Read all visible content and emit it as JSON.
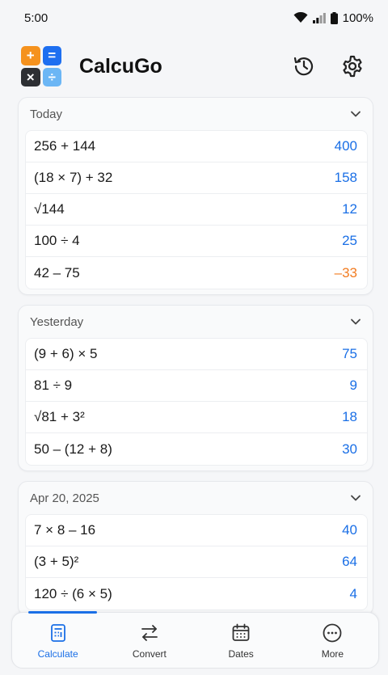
{
  "status": {
    "time": "5:00",
    "battery": "100%"
  },
  "header": {
    "title": "CalcuGo",
    "logo": [
      {
        "symbol": "+",
        "color": "#f5921e"
      },
      {
        "symbol": "=",
        "color": "#1e6ff0"
      },
      {
        "symbol": "×",
        "color": "#2d2f33"
      },
      {
        "symbol": "÷",
        "color": "#6bb6f5"
      }
    ]
  },
  "colors": {
    "accent": "#1a6fe6",
    "positive": "#1a6fe6",
    "negative": "#f27c21"
  },
  "groups": [
    {
      "label": "Today",
      "rows": [
        {
          "expr": "256 + 144",
          "result": "400",
          "negative": false
        },
        {
          "expr": "(18 × 7) + 32",
          "result": "158",
          "negative": false
        },
        {
          "expr": "√144",
          "result": "12",
          "negative": false
        },
        {
          "expr": "100 ÷ 4",
          "result": "25",
          "negative": false
        },
        {
          "expr": "42 – 75",
          "result": "–33",
          "negative": true
        }
      ]
    },
    {
      "label": "Yesterday",
      "rows": [
        {
          "expr": "(9 + 6) × 5",
          "result": "75",
          "negative": false
        },
        {
          "expr": "81 ÷ 9",
          "result": "9",
          "negative": false
        },
        {
          "expr": "√81 + 3²",
          "result": "18",
          "negative": false
        },
        {
          "expr": "50 – (12 + 8)",
          "result": "30",
          "negative": false
        }
      ]
    },
    {
      "label": "Apr 20, 2025",
      "rows": [
        {
          "expr": "7 × 8 – 16",
          "result": "40",
          "negative": false
        },
        {
          "expr": "(3 + 5)²",
          "result": "64",
          "negative": false
        },
        {
          "expr": "120 ÷ (6 × 5)",
          "result": "4",
          "negative": false
        }
      ]
    }
  ],
  "nav": {
    "active": "Calculate",
    "items": [
      {
        "label": "Calculate",
        "icon": "calculator-icon"
      },
      {
        "label": "Convert",
        "icon": "swap-arrows-icon"
      },
      {
        "label": "Dates",
        "icon": "calendar-icon"
      },
      {
        "label": "More",
        "icon": "more-dots-icon"
      }
    ]
  }
}
